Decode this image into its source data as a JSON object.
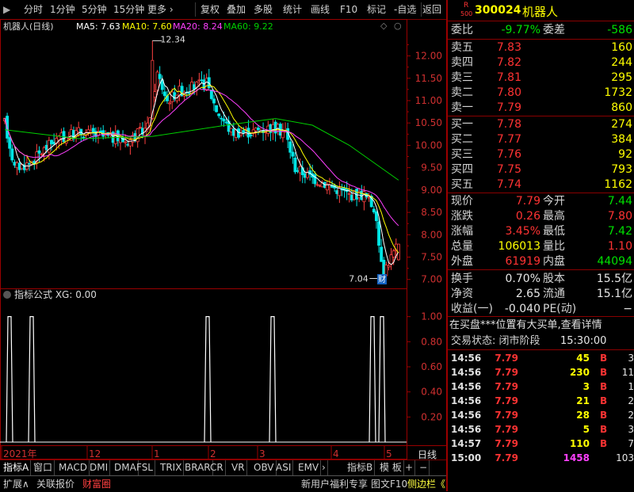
{
  "toolbar": {
    "items": [
      "分时",
      "1分钟",
      "5分钟",
      "15分钟",
      "更多 ›",
      "复权",
      "叠加",
      "多股",
      "统计",
      "画线",
      "F10",
      "标记",
      "-自选",
      "返回"
    ]
  },
  "chart": {
    "stock_title": "机器人(日线)",
    "ma5_label": "MA5: 7.63",
    "ma10_label": "MA10: 7.60",
    "ma20_label": "MA20: 8.24",
    "ma60_label": "MA60: 9.22",
    "high_marker": "12.34",
    "low_marker": "7.04",
    "cai_badge": "财",
    "price_ticks": [
      "12.00",
      "11.50",
      "11.00",
      "10.50",
      "10.00",
      "9.50",
      "9.00",
      "8.50",
      "8.00",
      "7.50",
      "7.00"
    ],
    "indicator_title": "指标公式 XG: 0.00",
    "indicator_ticks": [
      "1.00",
      "0.80",
      "0.60",
      "0.40",
      "0.20"
    ],
    "date_labels": [
      "2021年",
      "12",
      "1",
      "2",
      "3",
      "4",
      "5"
    ],
    "colors": {
      "ma5": "#ffffff",
      "ma10": "#ffff00",
      "ma20": "#ff40ff",
      "ma60": "#00d000",
      "up": "#ff4040",
      "down": "#00e5e5",
      "grid": "#9a0000"
    }
  },
  "chart_data": {
    "type": "candlestick",
    "ylim": [
      6.8,
      12.4
    ],
    "high": 12.34,
    "low": 7.04,
    "ma": {
      "MA5": 7.63,
      "MA10": 7.6,
      "MA20": 8.24,
      "MA60": 9.22
    },
    "indicator": {
      "name": "XG",
      "value": 0.0,
      "ylim": [
        0,
        1
      ],
      "signal_peaks_bar_index": [
        3,
        5,
        63,
        90,
        114,
        116
      ]
    }
  },
  "bottom_tabs": {
    "items": [
      "指标A",
      "窗口",
      "MACD",
      "DMI",
      "DMA",
      "FSL",
      "TRIX",
      "BRAR",
      "CR",
      "VR",
      "OBV",
      "ASI",
      "EMV",
      "›",
      "指标B",
      "模 板",
      "+",
      "−"
    ]
  },
  "status_bar": {
    "left": [
      "扩展∧",
      "关联报价",
      "财富圈"
    ],
    "middle": [
      "新用户福利专享",
      "图文F10",
      "侧边栏《"
    ],
    "right": [
      "笔",
      "价",
      "细",
      "势",
      "联",
      "值",
      "主",
      "筹"
    ]
  },
  "quote": {
    "code": "300024",
    "name": "机器人",
    "r_tag": "R",
    "idx_tag": "500",
    "weibi_label": "委比",
    "weibi_value": "-9.77%",
    "weicha_label": "委差",
    "weicha_value": "-586",
    "sell": [
      {
        "label": "卖五",
        "price": "7.83",
        "vol": "160"
      },
      {
        "label": "卖四",
        "price": "7.82",
        "vol": "244"
      },
      {
        "label": "卖三",
        "price": "7.81",
        "vol": "295"
      },
      {
        "label": "卖二",
        "price": "7.80",
        "vol": "1732"
      },
      {
        "label": "卖一",
        "price": "7.79",
        "vol": "860"
      }
    ],
    "buy": [
      {
        "label": "买一",
        "price": "7.78",
        "vol": "274"
      },
      {
        "label": "买二",
        "price": "7.77",
        "vol": "384"
      },
      {
        "label": "买三",
        "price": "7.76",
        "vol": "92"
      },
      {
        "label": "买四",
        "price": "7.75",
        "vol": "793"
      },
      {
        "label": "买五",
        "price": "7.74",
        "vol": "1162"
      }
    ],
    "stats": [
      {
        "l1": "现价",
        "v1": "7.79",
        "l2": "今开",
        "v2": "7.44"
      },
      {
        "l1": "涨跌",
        "v1": "0.26",
        "l2": "最高",
        "v2": "7.80"
      },
      {
        "l1": "涨幅",
        "v1": "3.45%",
        "l2": "最低",
        "v2": "7.42"
      },
      {
        "l1": "总量",
        "v1": "106013",
        "l2": "量比",
        "v2": "1.10"
      },
      {
        "l1": "外盘",
        "v1": "61919",
        "l2": "内盘",
        "v2": "44094"
      }
    ],
    "stats2": [
      {
        "l1": "换手",
        "v1": "0.70%",
        "l2": "股本",
        "v2": "15.5亿"
      },
      {
        "l1": "净资",
        "v1": "2.65",
        "l2": "流通",
        "v2": "15.1亿"
      },
      {
        "l1": "收益(一)",
        "v1": "-0.040",
        "l2": "PE(动)",
        "v2": "−"
      }
    ],
    "news": "在买盘***位置有大买单,查看详情",
    "trade_state_label": "交易状态: 闭市阶段",
    "trade_state_time": "15:30:00",
    "ticks": [
      {
        "time": "14:56",
        "price": "7.79",
        "vol": "45",
        "bs": "B",
        "n": "3"
      },
      {
        "time": "14:56",
        "price": "7.79",
        "vol": "230",
        "bs": "B",
        "n": "11"
      },
      {
        "time": "14:56",
        "price": "7.79",
        "vol": "3",
        "bs": "B",
        "n": "1"
      },
      {
        "time": "14:56",
        "price": "7.79",
        "vol": "21",
        "bs": "B",
        "n": "2"
      },
      {
        "time": "14:56",
        "price": "7.79",
        "vol": "28",
        "bs": "B",
        "n": "2"
      },
      {
        "time": "14:56",
        "price": "7.79",
        "vol": "5",
        "bs": "B",
        "n": "3"
      },
      {
        "time": "14:57",
        "price": "7.79",
        "vol": "110",
        "bs": "B",
        "n": "7"
      },
      {
        "time": "15:00",
        "price": "7.79",
        "vol": "1458",
        "bs": "",
        "n": "103"
      }
    ],
    "bottom_label": "日线"
  }
}
